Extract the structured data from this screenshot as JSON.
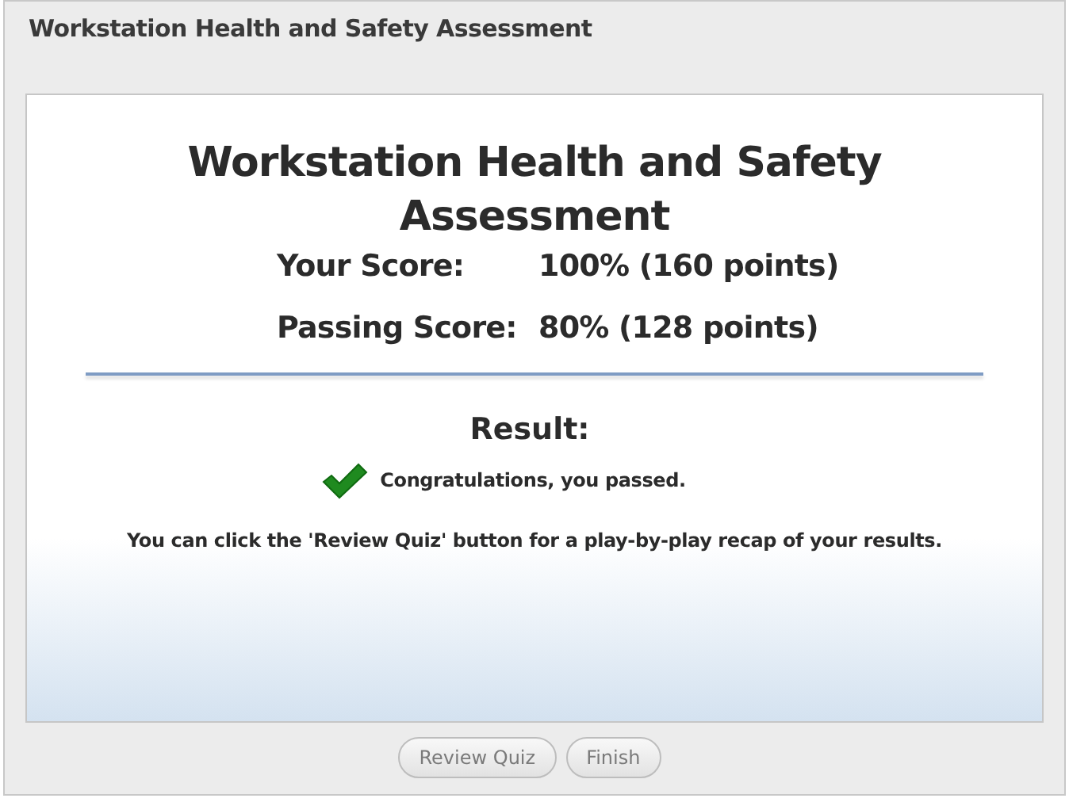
{
  "window": {
    "title": "Workstation Health and Safety Assessment"
  },
  "heading": "Workstation Health and Safety Assessment",
  "scores": [
    {
      "label": "Your Score:",
      "value": "100% (160 points)"
    },
    {
      "label": "Passing Score:",
      "value": "80% (128 points)"
    }
  ],
  "result": {
    "label": "Result:",
    "passed": true,
    "message": "Congratulations, you passed."
  },
  "info": "You can click the 'Review Quiz' button for a play-by-play recap of your results.",
  "buttons": [
    {
      "label": "Review Quiz",
      "disabled": true
    },
    {
      "label": "Finish",
      "disabled": true
    }
  ]
}
